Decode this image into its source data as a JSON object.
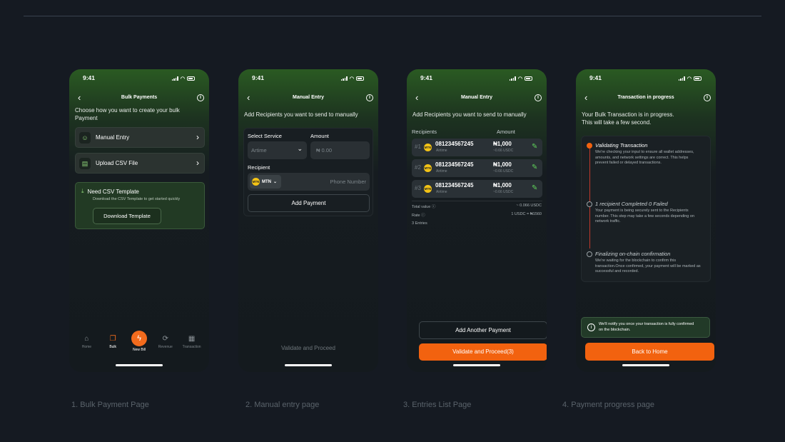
{
  "status_time": "9:41",
  "screen1": {
    "title": "Bulk Payments",
    "subtitle": "Choose how you want to create your bulk Payment",
    "option1": "Manual Entry",
    "option2": "Upload CSV File",
    "template_title": "Need CSV Template",
    "template_desc": "Download the CSV Template to get started quickly",
    "template_button": "Download Template",
    "tabs": [
      "Home",
      "Bulk",
      "New Bill",
      "Revenue",
      "Transaction"
    ]
  },
  "screen2": {
    "title": "Manual Entry",
    "subtitle": "Add Recipients you want to send to manually",
    "service_label": "Select Service",
    "service_value": "Artime",
    "amount_label": "Amount",
    "amount_placeholder": "₦ 0.00",
    "recipient_label": "Recipient",
    "network": "MTN",
    "phone_placeholder": "Phone Number",
    "add_button": "Add Payment",
    "proceed_button": "Validate and Proceed"
  },
  "screen3": {
    "title": "Manual Entry",
    "subtitle": "Add Recipients you want to send to manually",
    "col_recipients": "Recipients",
    "col_amount": "Amount",
    "entries": [
      {
        "num": "#1",
        "phone": "081234567245",
        "type": "Airtime",
        "amount": "₦1,000",
        "usdc": "~0.66 USDC"
      },
      {
        "num": "#2",
        "phone": "081234567245",
        "type": "Airtime",
        "amount": "₦1,000",
        "usdc": "~0.66 USDC"
      },
      {
        "num": "#3",
        "phone": "081234567245",
        "type": "Airtime",
        "amount": "₦1,000",
        "usdc": "~0.66 USDC"
      }
    ],
    "total_label": "Total value",
    "total_value": "~ 0.066 USDC",
    "rate_label": "Rate",
    "rate_value": "1 USDC = ₦1560",
    "entries_count": "3 Entries",
    "add_another": "Add Another Payment",
    "proceed": "Validate and Proceed(3)"
  },
  "screen4": {
    "title": "Transaction in progress",
    "subtitle": "Your Bulk Transaction is in progress. This will take a few second.",
    "steps": [
      {
        "title": "Validating Transaction",
        "desc": "We're checking your input to ensure all wallet addresses, amounts, and network settings are correct. This helps prevent failed or delayed transactions."
      },
      {
        "title": "1 recipient Completed 0 Failed",
        "desc": "Your payment is being securely sent to the Recipients number. This step may take a few seconds depending on network traffic."
      },
      {
        "title": "Finalizing on-chain confirmation",
        "desc": "We're waiting for the blockchain to confirm this transaction.Once confirmed, your payment will be marked as successful and recorded."
      }
    ],
    "notice": "We'll notify you once your transaction is fully confirmed on the blockchain.",
    "home_button": "Back to Home"
  },
  "captions": [
    "1. Bulk Payment Page",
    "2. Manual entry page",
    "3. Entries List Page",
    "4. Payment progress page"
  ],
  "colors": {
    "accent": "#f2620f",
    "success": "#5fd05a",
    "background": "#151a22"
  }
}
